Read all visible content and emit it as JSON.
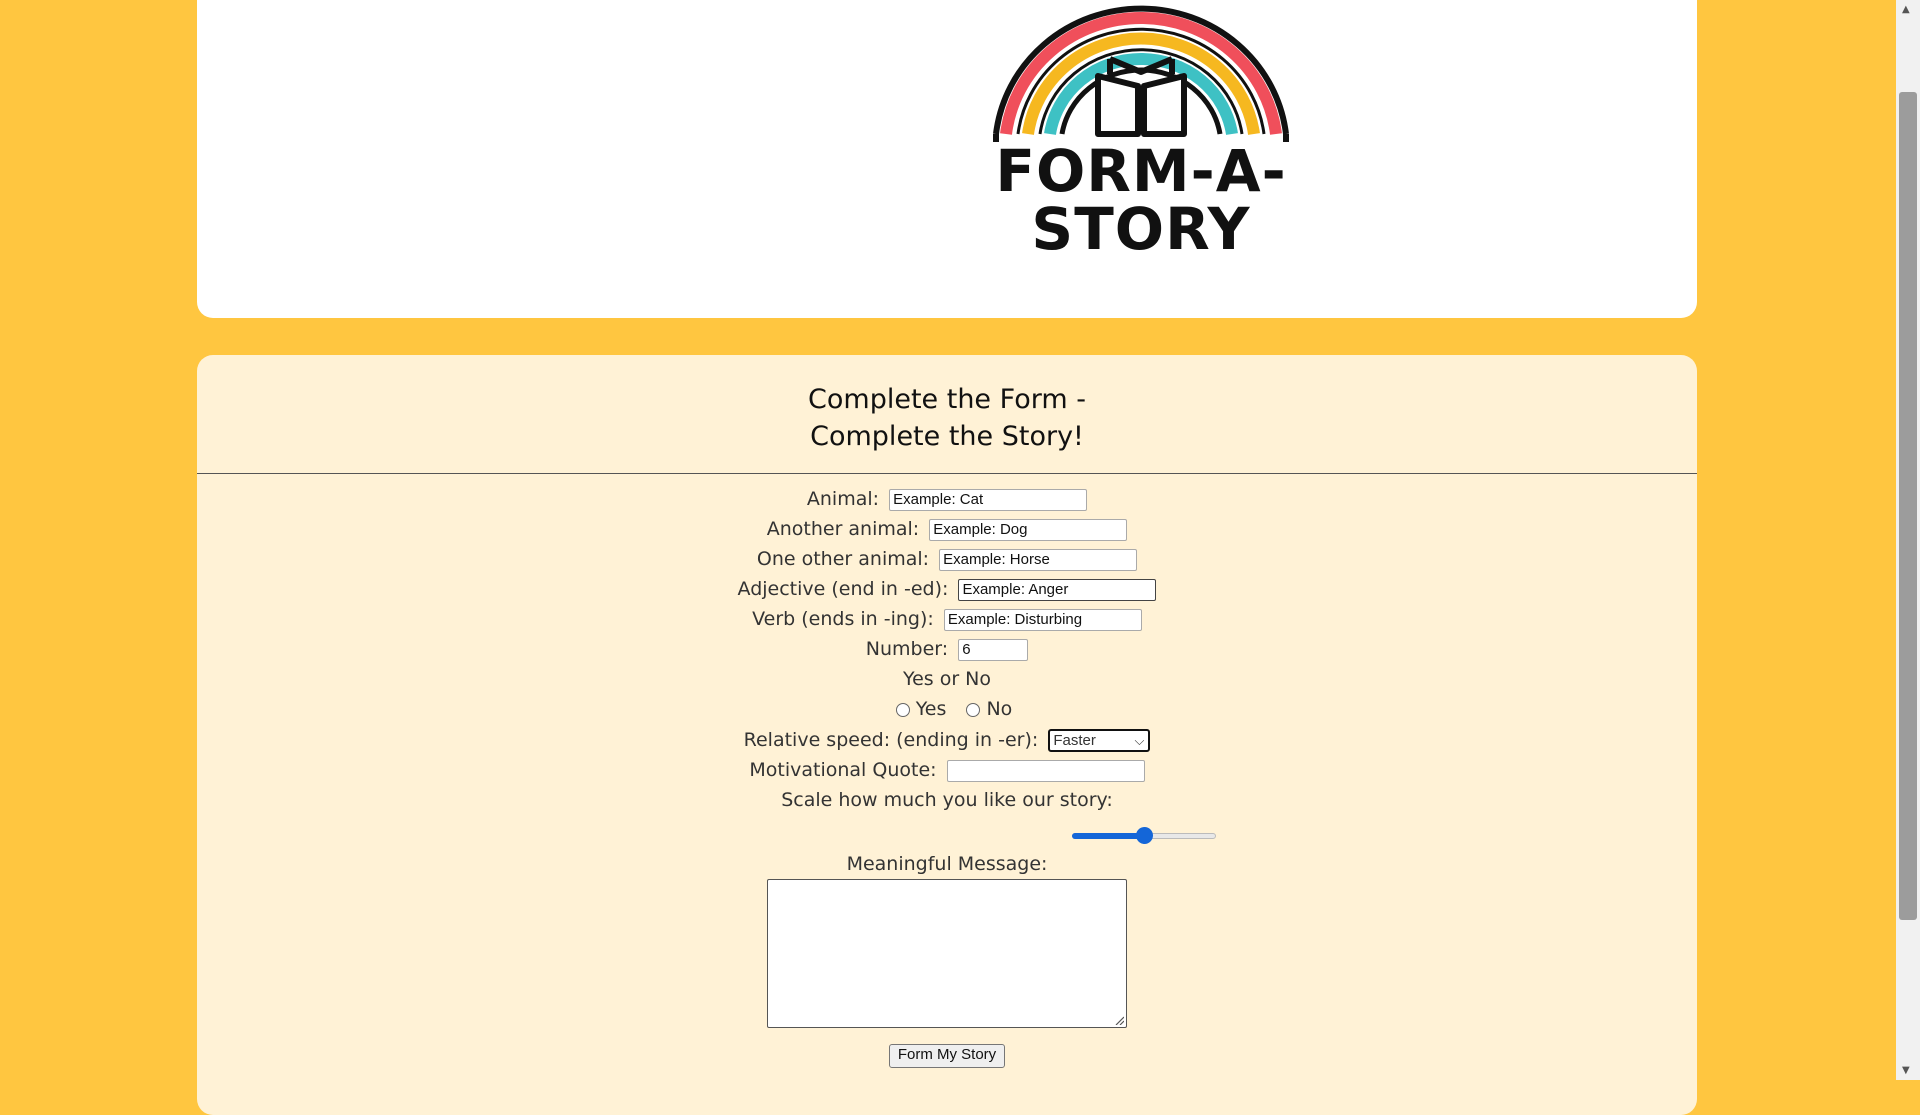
{
  "brand": {
    "name": "FORM-A-STORY"
  },
  "form": {
    "title_line1": "Complete the Form -",
    "title_line2": "Complete the Story!",
    "fields": {
      "animal": {
        "label": "Animal:",
        "value": "Example: Cat"
      },
      "another_animal": {
        "label": "Another animal:",
        "value": "Example: Dog"
      },
      "other_animal": {
        "label": "One other animal:",
        "value": "Example: Horse"
      },
      "adjective": {
        "label": "Adjective (end in -ed):",
        "value": "Example: Anger"
      },
      "verb": {
        "label": "Verb (ends in -ing):",
        "value": "Example: Disturbing"
      },
      "number": {
        "label": "Number:",
        "value": "6"
      },
      "yes_no": {
        "label": "Yes or No",
        "yes": "Yes",
        "no": "No"
      },
      "speed": {
        "label": "Relative speed: (ending in -er):",
        "selected": "Faster"
      },
      "quote": {
        "label": "Motivational Quote:",
        "value": ""
      },
      "scale": {
        "label": "Scale how much you like our story:",
        "level": 0.5
      },
      "message": {
        "label": "Meaningful Message:",
        "value": ""
      }
    },
    "submit_label": "Form My Story"
  },
  "colors": {
    "background": "#ffc640",
    "card": "#fff2d6",
    "accent": "#1466d8"
  }
}
